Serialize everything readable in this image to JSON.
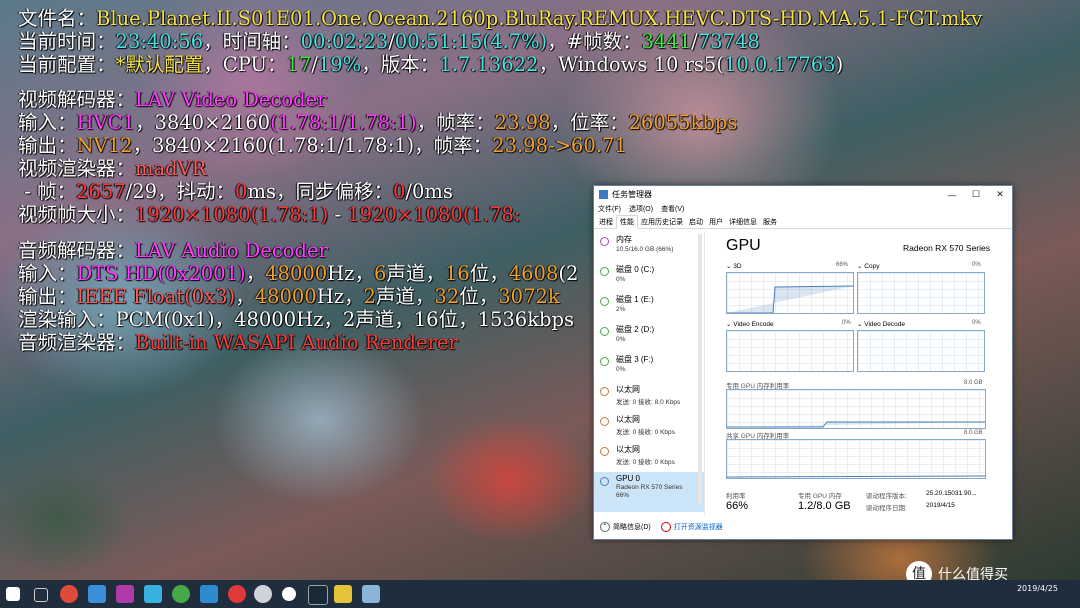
{
  "osd": {
    "line1": {
      "label": "文件名：",
      "file": "Blue.Planet.II.S01E01.One.Ocean.2160p.BluRay.REMUX.HEVC.DTS-HD.MA.5.1-FGT.mkv"
    },
    "line2": {
      "label": "当前时间：",
      "time": "23:40:56",
      "sep1": "，时间轴：",
      "pos": "00:02:23",
      "slash": "/",
      "dur": "00:51:15",
      "pct": "(4.7%)",
      "sep2": "，#帧数：",
      "frame": "3441",
      "slash2": "/",
      "frames": "73748"
    },
    "line3": {
      "label": "当前配置：",
      "cfg": "*默认配置",
      "sep1": "，CPU：",
      "cpu": "17",
      "slash": "/",
      "cpu2": "19%",
      "sep2": "，版本：",
      "ver": "1.7.13622",
      "sep3": "，Windows 10 rs5(",
      "build": "10.0.17763",
      "end": ")"
    },
    "line4": {
      "label": "视频解码器：",
      "val": "LAV Video Decoder"
    },
    "line5": {
      "label": "输入：",
      "codec": "HVC1",
      "c1": "，",
      "w": "3840",
      "x": "×",
      "h": "2160",
      "ar": "(1.78:1/1.78:1)",
      "c2": "，帧率：",
      "fps": "23.98",
      "c3": "，位率：",
      "br": "26055kbps"
    },
    "line6": {
      "label": "输出：",
      "fmt": "NV12",
      "rest": "，3840×2160(1.78:1/1.78:1)，帧率：",
      "fps": "23.98->60.71"
    },
    "line7": {
      "label": "视频渲染器：",
      "val": "madVR"
    },
    "line8": {
      "label": " - 帧：",
      "a": "2657",
      "s": "/29，抖动：",
      "b": "0",
      "ms": "ms，同步偏移：",
      "c": "0",
      "end": "/0ms"
    },
    "line9": {
      "label": "视频帧大小：",
      "v1": "1920×1080",
      "a1": "(1.78:1)",
      "mid": " - ",
      "v2": "1920×1080",
      "a2": "(1.78:"
    },
    "line10": {
      "label": "音频解码器：",
      "val": "LAV Audio Decoder"
    },
    "line11": {
      "label": "输入：",
      "codec": "DTS HD",
      "hex": "(0x2001)",
      "c1": "，",
      "hz": "48000",
      "hzu": "Hz，",
      "ch": "6",
      "chu": "声道，",
      "bit": "16",
      "bitu": "位，",
      "kb": "4608",
      "end": "(2"
    },
    "line12": {
      "label": "输出：",
      "fmt": "IEEE Float",
      "hex": "(0x3)",
      "c1": "，",
      "hz": "48000",
      "hzu": "Hz，",
      "ch": "2",
      "chu": "声道，",
      "bit": "32",
      "bitu": "位，",
      "kb": "3072k"
    },
    "line13": {
      "label": "渲染输入：",
      "val": "PCM(0x1)，48000Hz，2声道，16位，1536kbps"
    },
    "line14": {
      "label": "音频渲染器：",
      "val": "Built-in WASAPI Audio Renderer"
    }
  },
  "taskmgr": {
    "title": "任务管理器",
    "menu": [
      "文件(F)",
      "选项(O)",
      "查看(V)"
    ],
    "tabs": [
      "进程",
      "性能",
      "应用历史记录",
      "启动",
      "用户",
      "详细信息",
      "服务"
    ],
    "active_tab": "性能",
    "side": [
      {
        "name": "内存",
        "sub": "10.5/16.0 GB (66%)",
        "color": "#9b4fb5"
      },
      {
        "name": "磁盘 0 (C:)",
        "sub": "0%",
        "color": "#4aa84a"
      },
      {
        "name": "磁盘 1 (E:)",
        "sub": "2%",
        "color": "#4aa84a"
      },
      {
        "name": "磁盘 2 (D:)",
        "sub": "0%",
        "color": "#4aa84a"
      },
      {
        "name": "磁盘 3 (F:)",
        "sub": "0%",
        "color": "#4aa84a"
      },
      {
        "name": "以太网",
        "sub": "发送: 0 接收: 8.0 Kbps",
        "color": "#c07a3a"
      },
      {
        "name": "以太网",
        "sub": "发送: 0 接收: 0 Kbps",
        "color": "#c07a3a"
      },
      {
        "name": "以太网",
        "sub": "发送: 0 接收: 0 Kbps",
        "color": "#c07a3a"
      },
      {
        "name": "GPU 0",
        "sub": "Radeon RX 570 Series",
        "sub2": "66%",
        "color": "#4a80b5"
      }
    ],
    "gpu": {
      "title": "GPU",
      "model": "Radeon RX 570 Series",
      "g3d": "3D",
      "g3d_pct": "66%",
      "copy": "Copy",
      "copy_pct": "0%",
      "venc": "Video Encode",
      "venc_pct": "0%",
      "vdec": "Video Decode",
      "vdec_pct": "0%",
      "ded": "专用 GPU 内存利用率",
      "ded_max": "8.0 GB",
      "shared": "共享 GPU 内存利用率",
      "shared_max": "8.0 GB",
      "util_lbl": "利用率",
      "util_val": "66%",
      "dmem_lbl": "专用 GPU 内存",
      "dmem_val": "1.2/8.0 GB",
      "drv_ver_lbl": "驱动程序版本:",
      "drv_ver": "25.20.15031.90...",
      "drv_date_lbl": "驱动程序日期:",
      "drv_date": "2019/4/15"
    },
    "footer": {
      "summary": "简略信息(D)",
      "link": "打开资源监视器"
    }
  },
  "taskbar": {
    "time": "2019/4/25"
  },
  "watermark": {
    "text": "什么值得买",
    "logo": "值"
  }
}
